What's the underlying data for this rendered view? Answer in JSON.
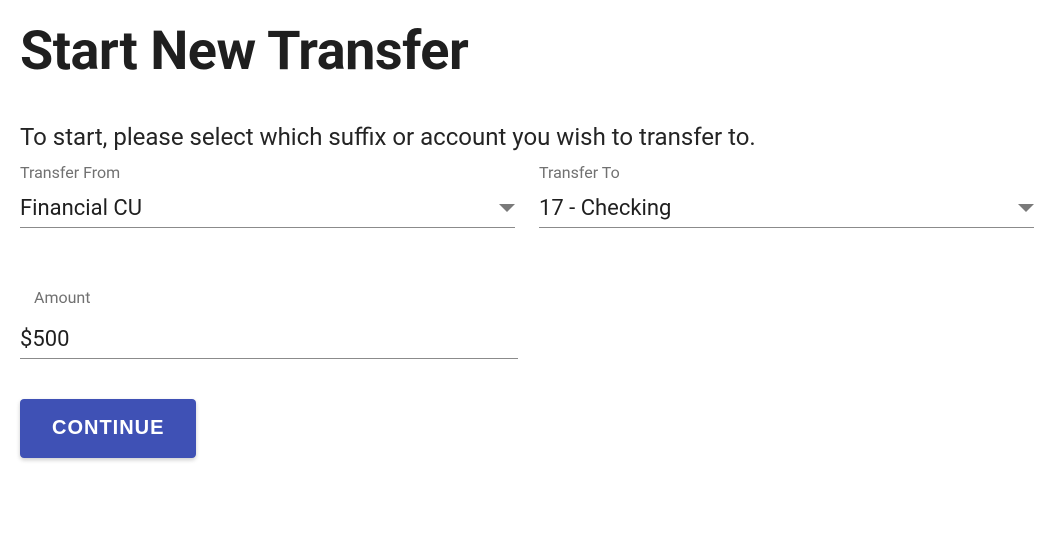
{
  "title": "Start New Transfer",
  "instruction": "To start, please select which suffix or account you wish to transfer to.",
  "transferFrom": {
    "label": "Transfer From",
    "value": "Financial CU"
  },
  "transferTo": {
    "label": "Transfer To",
    "value": "17 - Checking"
  },
  "amount": {
    "label": "Amount",
    "value": "$500"
  },
  "continueLabel": "CONTINUE"
}
